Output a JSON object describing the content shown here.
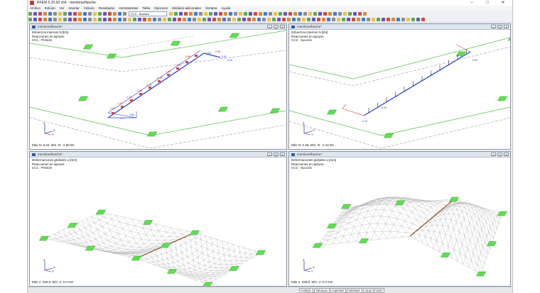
{
  "app": {
    "title": "RFEM 5.20.00 x64 - membranflasche"
  },
  "window_buttons": [
    "–",
    "□",
    "✕"
  ],
  "menu": [
    "Archivo",
    "Edición",
    "Ver",
    "Insertar",
    "Cálculo",
    "Resultados",
    "Herramientas",
    "Tabla",
    "Opciones",
    "Módulos adicionales",
    "Ventana",
    "Ayuda"
  ],
  "toolbar": {
    "loadcase": "CC2 - Succión"
  },
  "panes": [
    {
      "title": "membranflasche*",
      "info": [
        "Esfuerzos internos N [kN]",
        "Reacciones en apoyos",
        "CC1 - Presión"
      ],
      "minmax": "Máx N: 8.40, Mín. N: -2.88 kN",
      "labels": [
        "-0.88",
        "-1.01",
        "-1.38",
        "-1.16",
        "-1.44",
        "-2.83",
        "-1.43",
        "-1.41",
        "-1.63",
        "-2.86",
        "0.81",
        "8.40",
        "1.52",
        "-1.17",
        "0.88"
      ]
    },
    {
      "title": "membranflasche*",
      "info": [
        "Esfuerzos internos N [kN]",
        "Reacciones en apoyos",
        "CC2 - Succión"
      ],
      "minmax": "Máx N: 0.26, Mín. N: -2.44 kN",
      "labels": [
        "0.26",
        "-2.44",
        "0.25"
      ]
    },
    {
      "title": "membranflasche*",
      "info": [
        "Deformaciones globales u [mm]",
        "Reacciones en apoyos",
        "CC1 - Presión"
      ],
      "minmax": "Máx u: 250.8, Mín. u: 0.0 mm",
      "labels": []
    },
    {
      "title": "membranflasche*",
      "info": [
        "Deformaciones globales u [mm]",
        "Reacciones en apoyos",
        "CC2 - Succión"
      ],
      "minmax": "Máx u: 349.8, Mín. u: 0.0 mm",
      "labels": []
    }
  ],
  "pane_buttons": [
    "▭",
    "▢",
    "✕"
  ],
  "axes": {
    "x": "X",
    "y": "Y",
    "z": "Z"
  },
  "status": [
    "FORZC",
    "REJILLA",
    "CARTES",
    "REFENT",
    "GLAI",
    "DXF"
  ],
  "colors": {
    "support": "#5de04f",
    "edge": "#e04040",
    "beam": "#2a45c8",
    "mesh": "#a8a8a8"
  }
}
